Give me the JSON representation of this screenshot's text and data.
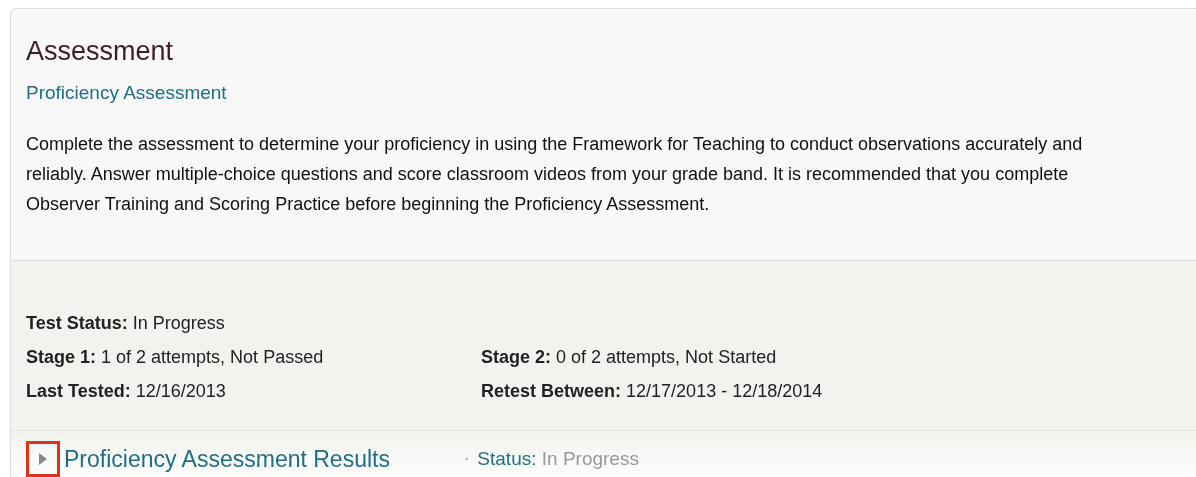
{
  "title": "Assessment",
  "subtitle": "Proficiency Assessment",
  "description": "Complete the assessment to determine your proficiency in using the Framework for Teaching to conduct observations accurately and reliably. Answer multiple-choice questions and score classroom videos from your grade band. It is recommended that you complete Observer Training and Scoring Practice before beginning the Proficiency Assessment.",
  "details": [
    [
      {
        "label": "Test Status:",
        "value": "In Progress"
      }
    ],
    [
      {
        "label": "Stage 1:",
        "value": "1 of 2 attempts, Not Passed"
      },
      {
        "label": "Stage 2:",
        "value": "0 of 2 attempts, Not Started"
      }
    ],
    [
      {
        "label": "Last Tested:",
        "value": "12/16/2013"
      },
      {
        "label": "Retest Between:",
        "value": "12/17/2013 - 12/18/2014"
      }
    ]
  ],
  "results": {
    "title": "Proficiency Assessment Results",
    "expanded": false,
    "highlighted": true,
    "separator": "·",
    "status_label": "Status:",
    "status_value": "In Progress"
  }
}
